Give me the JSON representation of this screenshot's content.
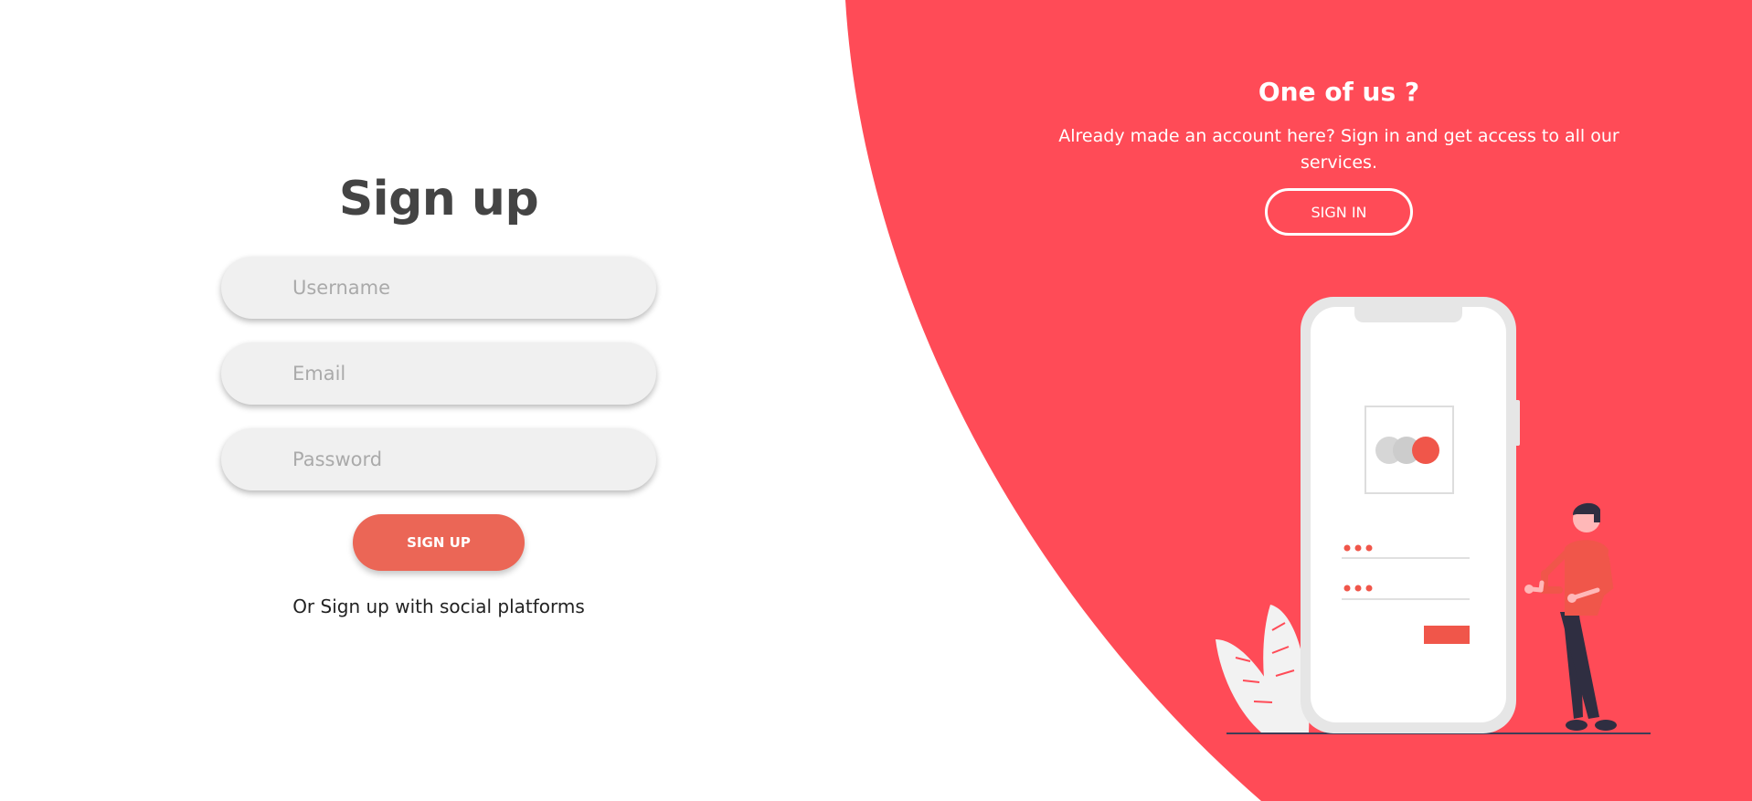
{
  "signup": {
    "title": "Sign up",
    "username_placeholder": "Username",
    "email_placeholder": "Email",
    "password_placeholder": "Password",
    "submit_label": "SIGN UP",
    "social_text": "Or Sign up with social platforms"
  },
  "panel": {
    "title": "One of us ?",
    "description": "Already made an account here? Sign in and get access to all our services.",
    "signin_label": "SIGN IN"
  },
  "colors": {
    "panel_bg": "#ff4b57",
    "primary_button": "#eb6656",
    "title_text": "#444444",
    "input_bg": "#f0f0f0"
  },
  "illustration": {
    "icons": [
      "phone-icon",
      "card-logo-icon",
      "person-icon",
      "plant-leaf-icon"
    ]
  }
}
